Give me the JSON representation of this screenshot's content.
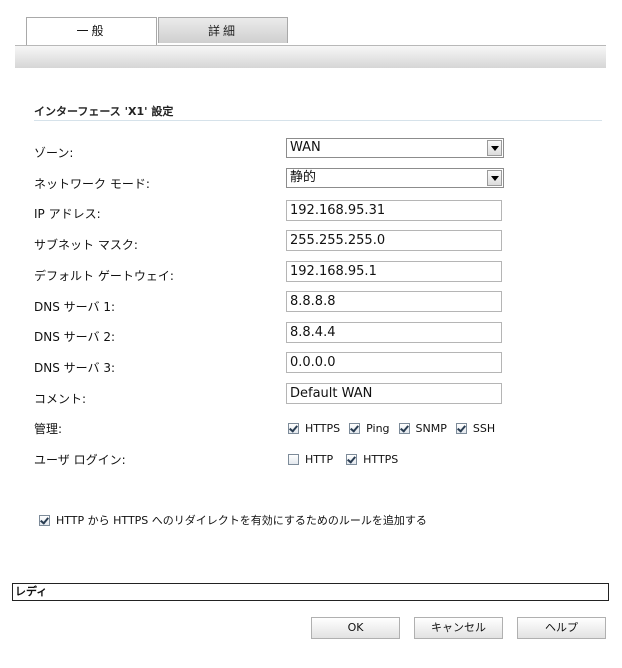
{
  "tabs": {
    "general": "一般",
    "advanced": "詳細"
  },
  "section": {
    "title": "インターフェース 'X1' 設定"
  },
  "form": {
    "zone_label": "ゾーン:",
    "zone_value": "WAN",
    "mode_label": "ネットワーク モード:",
    "mode_value": "静的",
    "ip_label": "IP アドレス:",
    "ip_value": "192.168.95.31",
    "subnet_label": "サブネット マスク:",
    "subnet_value": "255.255.255.0",
    "gateway_label": "デフォルト ゲートウェイ:",
    "gateway_value": "192.168.95.1",
    "dns1_label": "DNS サーバ 1:",
    "dns1_value": "8.8.8.8",
    "dns2_label": "DNS サーバ 2:",
    "dns2_value": "8.8.4.4",
    "dns3_label": "DNS サーバ 3:",
    "dns3_value": "0.0.0.0",
    "comment_label": "コメント:",
    "comment_value": "Default WAN",
    "management_label": "管理:",
    "user_login_label": "ユーザ ログイン:"
  },
  "management": [
    {
      "label": "HTTPS",
      "checked": true
    },
    {
      "label": "Ping",
      "checked": true
    },
    {
      "label": "SNMP",
      "checked": true
    },
    {
      "label": "SSH",
      "checked": true
    }
  ],
  "user_login": [
    {
      "label": "HTTP",
      "checked": false
    },
    {
      "label": "HTTPS",
      "checked": true
    }
  ],
  "redirect": {
    "label": "HTTP から HTTPS へのリダイレクトを有効にするためのルールを追加する",
    "checked": true
  },
  "status": {
    "text": "レディ"
  },
  "buttons": {
    "ok": "OK",
    "cancel": "キャンセル",
    "help": "ヘルプ"
  }
}
